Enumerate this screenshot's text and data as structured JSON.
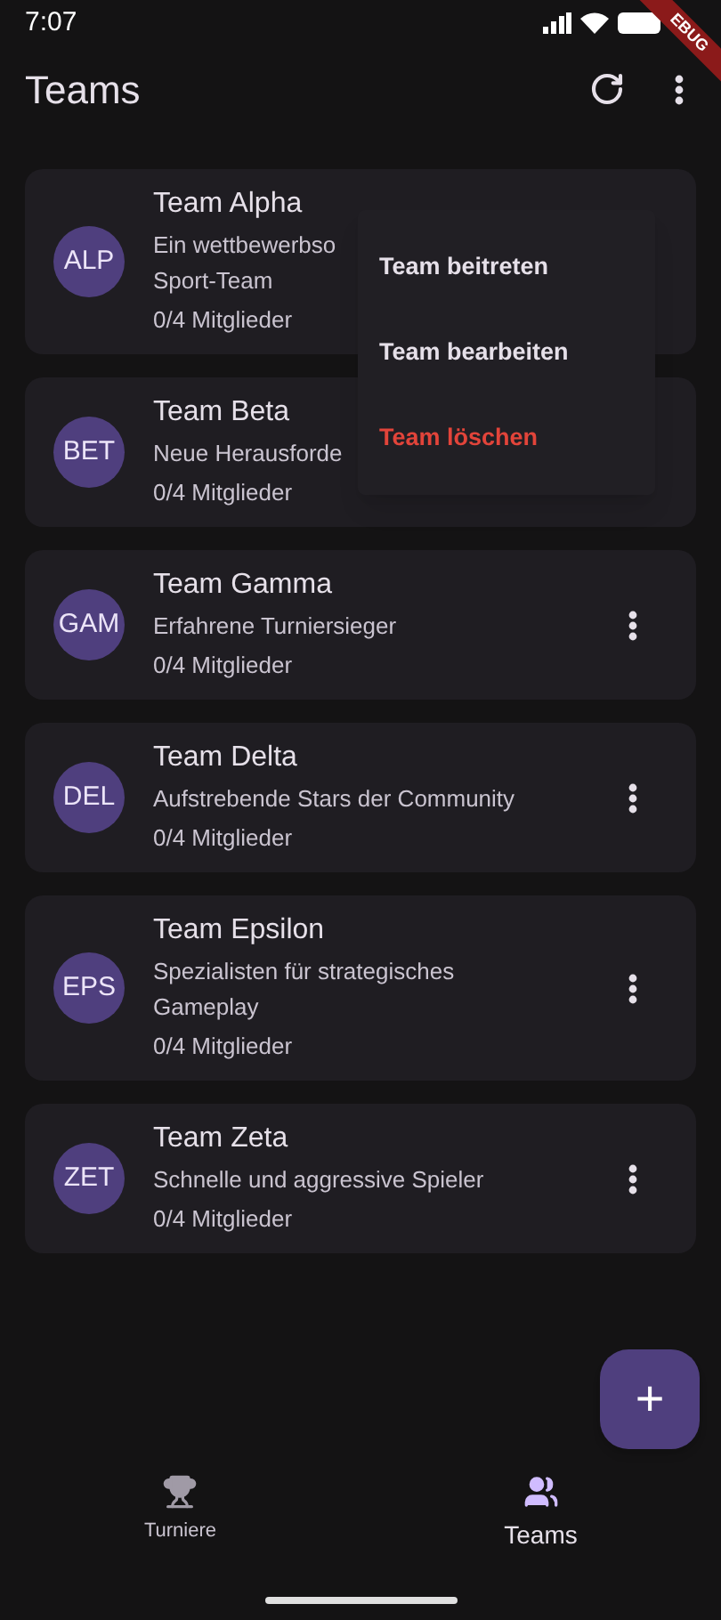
{
  "status_bar": {
    "time": "7:07"
  },
  "debug_banner": "EBUG",
  "app_bar": {
    "title": "Teams"
  },
  "teams": [
    {
      "avatar": "ALP",
      "name": "Team Alpha",
      "description": "Ein wettbewerbso",
      "description_line_2": "Sport-Team",
      "members": "0/4 Mitglieder"
    },
    {
      "avatar": "BET",
      "name": "Team Beta",
      "description": "Neue Herausforde",
      "members": "0/4 Mitglieder"
    },
    {
      "avatar": "GAM",
      "name": "Team Gamma",
      "description": "Erfahrene Turniersieger",
      "members": "0/4 Mitglieder"
    },
    {
      "avatar": "DEL",
      "name": "Team Delta",
      "description": "Aufstrebende Stars der Community",
      "members": "0/4 Mitglieder"
    },
    {
      "avatar": "EPS",
      "name": "Team Epsilon",
      "description": "Spezialisten für strategisches Gameplay",
      "members": "0/4 Mitglieder"
    },
    {
      "avatar": "ZET",
      "name": "Team Zeta",
      "description": "Schnelle und aggressive Spieler",
      "members": "0/4 Mitglieder"
    }
  ],
  "popup_menu": [
    {
      "label": "Team beitreten",
      "kind": "normal"
    },
    {
      "label": "Team bearbeiten",
      "kind": "normal"
    },
    {
      "label": "Team löschen",
      "kind": "danger"
    }
  ],
  "fab": "+",
  "nav": [
    {
      "label": "Turniere",
      "selected": false
    },
    {
      "label": "Teams",
      "selected": true
    }
  ]
}
